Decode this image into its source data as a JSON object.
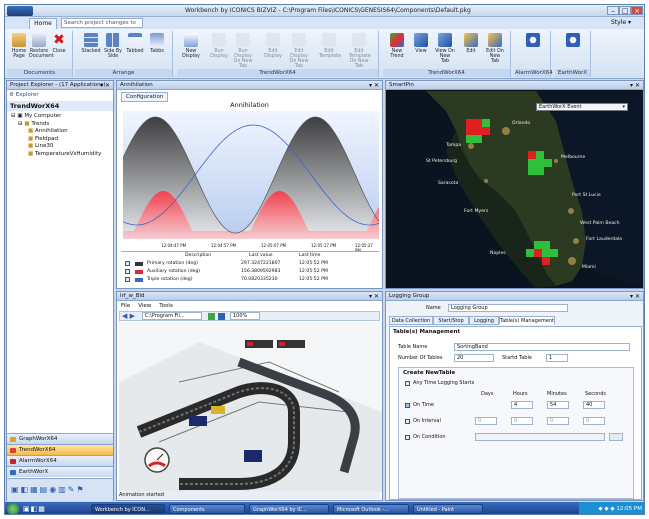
{
  "window": {
    "title": "Workbench by ICONICS BIZVIZ - C:\\Program Files\\ICONICS\\GENESIS64\\Components\\Default.pkg"
  },
  "ribbon": {
    "tab": "Home",
    "search_placeholder": "Search project changes to file",
    "style_menu": "Style ▾",
    "groups": [
      {
        "label": "Documents",
        "buttons": [
          "Home Page",
          "Restore Document",
          "Close"
        ]
      },
      {
        "label": "Arrange",
        "buttons": [
          "Stacked",
          "Side By Side",
          "Tabbed",
          "Tabbs"
        ]
      },
      {
        "label": "TrendWorX64",
        "buttons": [
          "New Display",
          "Run Display",
          "Run Display On New Tab",
          "Edit Display",
          "Edit Display On New Tab",
          "Edit Template",
          "Edit Template On New Tab"
        ]
      },
      {
        "label": "TrendWorX64",
        "buttons": [
          "New Trend",
          "View",
          "View On New Tab",
          "Edit",
          "Edit On New Tab"
        ]
      },
      {
        "label": "AlarmWorX64",
        "buttons": [
          ""
        ]
      },
      {
        "label": "EarthWorX",
        "buttons": [
          ""
        ]
      }
    ]
  },
  "explorer": {
    "title": "Project Explorer - (17 Applications)",
    "toolbar_label": "Explorer",
    "heading": "TrendWorX64",
    "tree": [
      "My Computer",
      "Trends",
      "Annihilation",
      "Fieldpad",
      "Line30",
      "TemperatureVsHumidity"
    ],
    "nav": [
      "GraphWorX64",
      "TrendWorX64",
      "AlarmWorX64",
      "EarthWorX"
    ]
  },
  "trend": {
    "tab": "Annihilation",
    "subtab": "Configuration",
    "title": "Annihilation",
    "legend_headers": [
      "Description",
      "Last value",
      "Last time"
    ],
    "legend_rows": [
      {
        "desc": "Primary rotation (deg)",
        "value": "297.3247221807",
        "time": "12:05:52 PM"
      },
      {
        "desc": "Auxiliary rotation (deg)",
        "value": "156.3809592983",
        "time": "12:05:52 PM"
      },
      {
        "desc": "Triple rotation (deg)",
        "value": "70.0820335230",
        "time": "12:05:52 PM"
      }
    ],
    "time_ticks": [
      "12:04:47 PM",
      "12:04:57 PM",
      "12:05:07 PM",
      "12:05:17 PM",
      "12:05:27 PM"
    ]
  },
  "smartpin": {
    "tab": "SmartPin",
    "dropdown": "EarthWorX Event",
    "cities": [
      "Orlando",
      "Tampa",
      "St Petersburg",
      "Sarasota",
      "Fort Myers",
      "Melbourne",
      "Port St Lucie",
      "West Palm Beach",
      "Fort Lauderdale",
      "Miami",
      "Naples"
    ]
  },
  "gwx": {
    "tab": "lrf_w_Bld",
    "menu": [
      "File",
      "View",
      "Tools"
    ],
    "path": "C:\\Program Fil...",
    "zoom": "100%",
    "status": "Animation started"
  },
  "logging": {
    "tab": "Logging Group",
    "name_label": "Name",
    "name_value": "Logging Group",
    "tabs": [
      "Data Collection",
      "Start/Stop",
      "Logging",
      "Table(s) Management"
    ],
    "section": "Table(s) Management",
    "table_name_label": "Table Name",
    "table_name_value": "SortingBand",
    "num_tables_label": "Number Of Tables",
    "num_tables_value": "20",
    "start_table_label": "Startd Table",
    "start_table_value": "1",
    "create_section": "Create NewTable",
    "any_time_label": "Any Time Logging Starts",
    "col_headers": [
      "Days",
      "Hours",
      "Minutes",
      "Seconds"
    ],
    "rows": [
      {
        "label": "On Time",
        "days": "",
        "hours": "4",
        "minutes": "54",
        "seconds": "40"
      },
      {
        "label": "On Interval",
        "days": "0",
        "hours": "0",
        "minutes": "0",
        "seconds": "0"
      },
      {
        "label": "On Condition",
        "days": "",
        "hours": "",
        "minutes": "",
        "seconds": ""
      }
    ]
  },
  "taskbar": {
    "items": [
      "Workbench by ICON...",
      "Components",
      "GraphWorX64 by IC...",
      "Microsoft Outlook -...",
      "Untitled - Paint"
    ],
    "clock": "12:05 PM"
  },
  "colors": {
    "accent": "#f6b94b",
    "ribbon": "#d3e2f4",
    "trend_red": "#e0283a",
    "trend_blue": "#3a67c8"
  }
}
